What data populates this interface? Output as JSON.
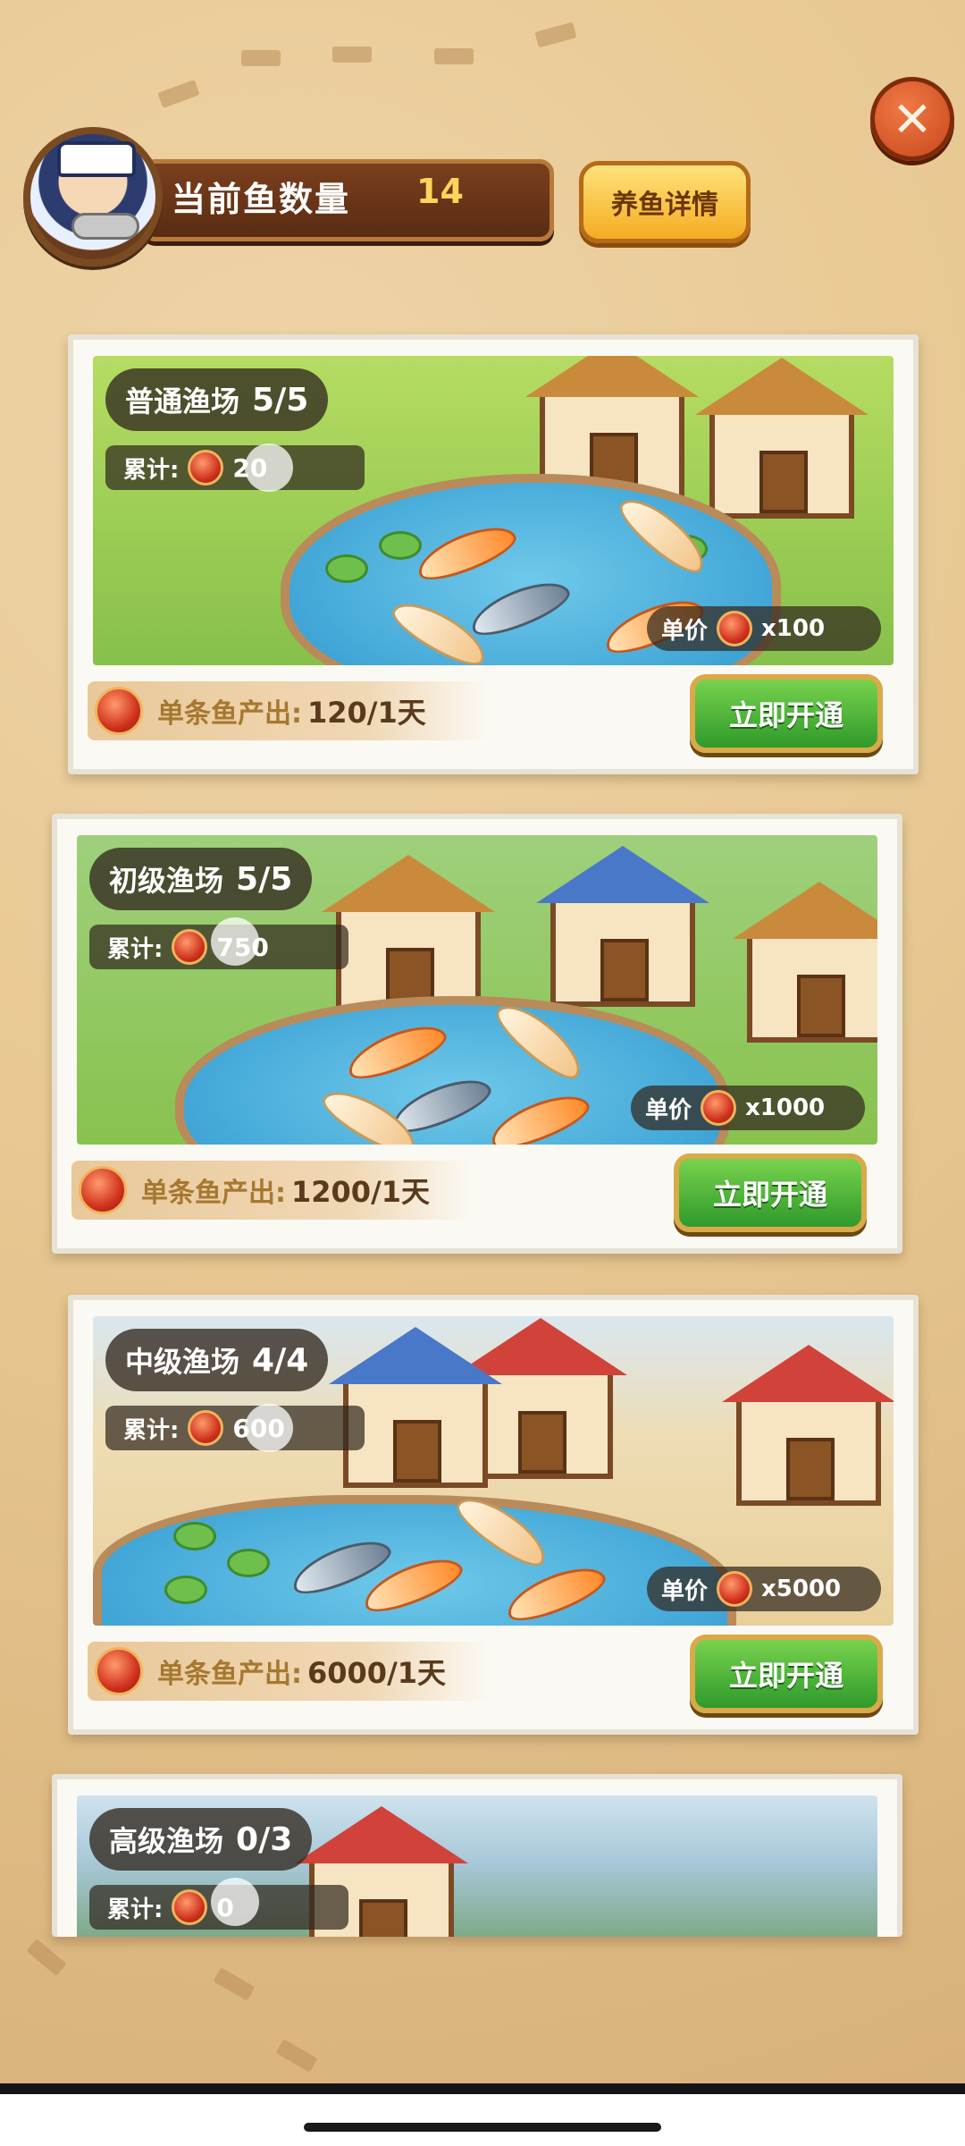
{
  "header": {
    "fish_count_label": "当前鱼数量",
    "fish_count_value": "14",
    "detail_button": "养鱼详情",
    "close_icon": "close-icon"
  },
  "farms": [
    {
      "name": "普通渔场",
      "slots": "5/5",
      "total_label": "累计:",
      "total_value": "20",
      "price_label": "单价",
      "price_value": "x100",
      "output_label": "单条鱼产出:",
      "output_value": "120/1天",
      "button": "立即开通",
      "scene_color": "#9ccf55"
    },
    {
      "name": "初级渔场",
      "slots": "5/5",
      "total_label": "累计:",
      "total_value": "750",
      "price_label": "单价",
      "price_value": "x1000",
      "output_label": "单条鱼产出:",
      "output_value": "1200/1天",
      "button": "立即开通",
      "scene_color": "#a8d15e"
    },
    {
      "name": "中级渔场",
      "slots": "4/4",
      "total_label": "累计:",
      "total_value": "600",
      "price_label": "单价",
      "price_value": "x5000",
      "output_label": "单条鱼产出:",
      "output_value": "6000/1天",
      "button": "立即开通",
      "scene_color": "#e8d5a8"
    },
    {
      "name": "高级渔场",
      "slots": "0/3",
      "total_label": "累计:",
      "total_value": "0"
    }
  ],
  "colors": {
    "background": "#e7c791",
    "button_green": "#2f9a2b",
    "button_gold": "#f4ac22",
    "bar_brown": "#5a2c13",
    "value_yellow": "#ffd45a"
  },
  "icons": [
    "sailor-avatar-icon",
    "close-icon",
    "red-gem-icon"
  ]
}
